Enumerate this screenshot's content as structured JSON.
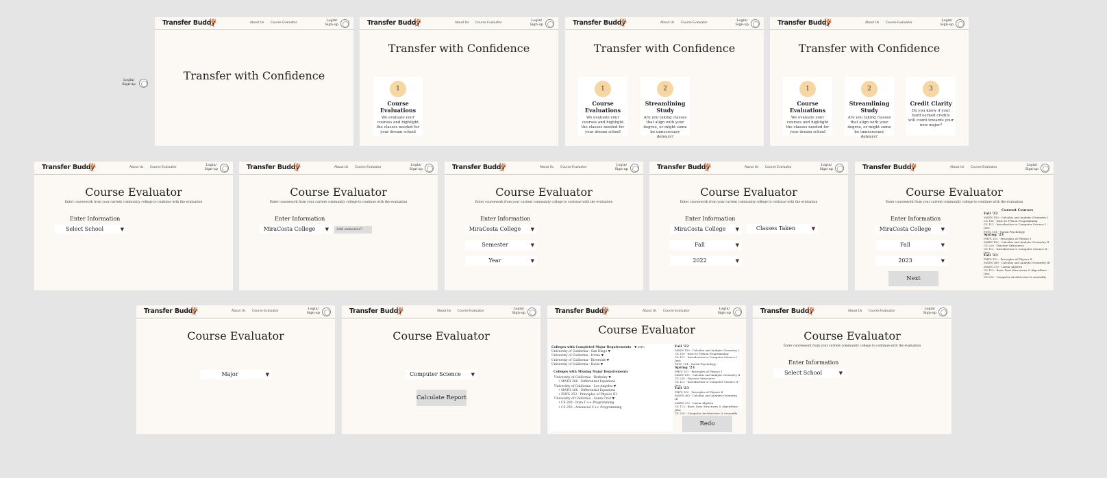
{
  "nav": {
    "logo": "Transfer Buddy",
    "about": "About Us",
    "evaluator": "Course Evaluator",
    "login_line1": "Login/",
    "login_line2": "Sign-up"
  },
  "home": {
    "title": "Transfer with Confidence",
    "cards": [
      {
        "num": "1",
        "title": "Course Evaluations",
        "text": "We evaluate your courses and highlight the classes needed for your dream school"
      },
      {
        "num": "2",
        "title": "Streamlining Study",
        "text": "Are you taking classes that align with your degree, or might some be unnecessary detours?"
      },
      {
        "num": "3",
        "title": "Credit Clarity",
        "text": "Do you know if your hard earned credits will count towards your new major?"
      }
    ]
  },
  "evaluator": {
    "title": "Course Evaluator",
    "subtitle": "Enter coursework from your current community college to continue with the evaluation",
    "enter_info": "Enter Information",
    "select_school": "Select School",
    "school": "MiraCosta College",
    "add_semester_placeholder": "Add semester?",
    "semester_placeholder": "Semester",
    "year_placeholder": "Year",
    "semester": "Fall",
    "year_2022": "2022",
    "year_2023": "2023",
    "classes_taken": "Classes Taken",
    "next": "Next",
    "major_placeholder": "Major",
    "major": "Computer Science",
    "calculate": "Calculate Report",
    "redo": "Redo",
    "current_courses_title": "Current Courses",
    "current_courses": [
      {
        "term": "Fall '22",
        "courses": [
          "MATH 150 - Calculus and Analytic Geometry I",
          "CS 150 - Intro to Python Programming",
          "CS 111 - Introduction to Computer Science I - Java",
          "PSYC 101 - Social Psychology"
        ]
      },
      {
        "term": "Spring '23",
        "courses": [
          "PHYS 151 - Principles of Physics I",
          "MATH 155 - Calculus and Analytic Geometry II",
          "CS 220 - Discrete Structures",
          "CS 112 - Introduction to Computer Science II - Java"
        ]
      },
      {
        "term": "Fall '23",
        "courses": [
          "PHYS 152 - Principles of Physics II",
          "MATH 260 - Calculus and Analytic Geometry III",
          "MATH 270 - Linear Algebra",
          "CS 113 - Basic Data Structures & Algorithms - Java",
          "CS 220 - Computer Architecture & Assembly"
        ]
      }
    ],
    "report": {
      "completed_title": "Colleges with Completed Major Requirements",
      "sort_label": "▼ sort:",
      "completed": [
        "University of California - San Diego ▼",
        "University of California - Irvine ▼",
        "University of California - Riverside ▼",
        "University of California - Davis ▼"
      ],
      "missing_title": "Colleges with Missing Major Requirements",
      "missing": [
        {
          "school": "University of California - Berkeley ▼",
          "courses": [
            "MATH 266 - Differential Equations"
          ]
        },
        {
          "school": "University of California - Los Angeles ▼",
          "courses": [
            "MATH 266 - Differential Equations",
            "PHYS 253 - Principles of Physics III"
          ]
        },
        {
          "school": "University of California - Santa Cruz ▼",
          "courses": [
            "CS 260 - Intro C++ Programming",
            "CS 255 - Advanced C++ Programming"
          ]
        }
      ]
    }
  }
}
